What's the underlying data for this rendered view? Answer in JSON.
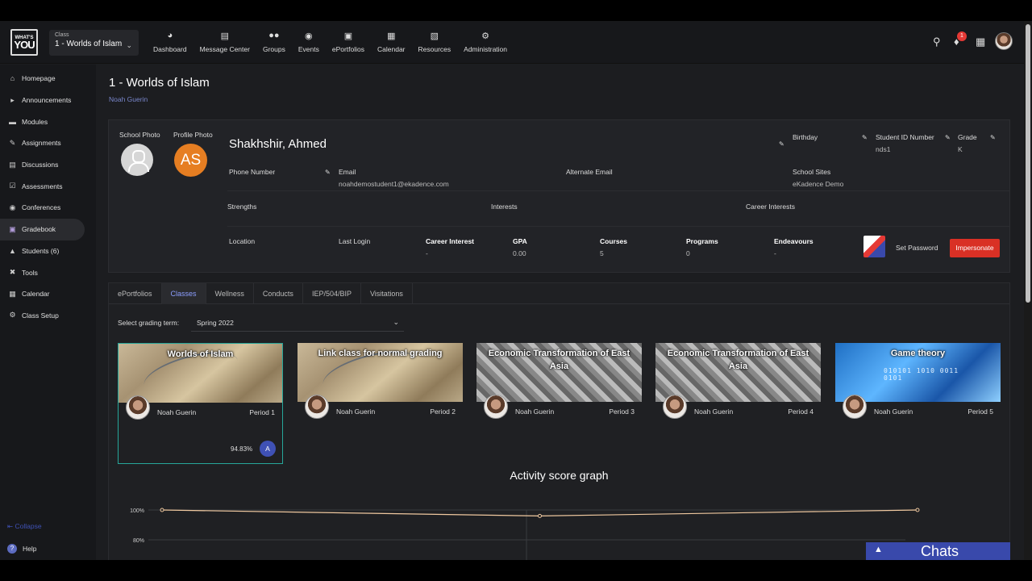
{
  "topbar": {
    "logo_line1": "WHAT'S",
    "logo_line2": "YOU",
    "class_caption": "Class",
    "class_value": "1 - Worlds of Islam",
    "nav": [
      {
        "label": "Dashboard",
        "icon": "dashboard-icon"
      },
      {
        "label": "Message Center",
        "icon": "message-icon"
      },
      {
        "label": "Groups",
        "icon": "groups-icon"
      },
      {
        "label": "Events",
        "icon": "map-pin-icon"
      },
      {
        "label": "ePortfolios",
        "icon": "portfolio-icon"
      },
      {
        "label": "Calendar",
        "icon": "calendar-icon"
      },
      {
        "label": "Resources",
        "icon": "resources-icon"
      },
      {
        "label": "Administration",
        "icon": "cogs-icon"
      }
    ],
    "notification_count": "1"
  },
  "sidebar": {
    "items": [
      {
        "label": "Homepage",
        "icon": "home-icon"
      },
      {
        "label": "Announcements",
        "icon": "megaphone-icon"
      },
      {
        "label": "Modules",
        "icon": "folder-icon"
      },
      {
        "label": "Assignments",
        "icon": "assignment-icon"
      },
      {
        "label": "Discussions",
        "icon": "discussion-icon"
      },
      {
        "label": "Assessments",
        "icon": "assessment-icon"
      },
      {
        "label": "Conferences",
        "icon": "conference-icon"
      },
      {
        "label": "Gradebook",
        "icon": "gradebook-icon"
      },
      {
        "label": "Students (6)",
        "icon": "graduation-cap-icon"
      },
      {
        "label": "Tools",
        "icon": "tools-icon"
      },
      {
        "label": "Calendar",
        "icon": "calendar-icon"
      },
      {
        "label": "Class Setup",
        "icon": "gear-icon"
      }
    ],
    "collapse_label": "Collapse",
    "help_label": "Help"
  },
  "page": {
    "title": "1 - Worlds of Islam",
    "teacher": "Noah Guerin"
  },
  "profile": {
    "school_photo_label": "School Photo",
    "profile_photo_label": "Profile Photo",
    "initials": "AS",
    "name": "Shakhshir, Ahmed",
    "birthday_label": "Birthday",
    "student_id_label": "Student ID Number",
    "student_id_value": "nds1",
    "grade_label": "Grade",
    "grade_value": "K",
    "phone_label": "Phone Number",
    "email_label": "Email",
    "email_value": "noahdemostudent1@ekadence.com",
    "alt_email_label": "Alternate Email",
    "school_sites_label": "School Sites",
    "school_sites_value": "eKadence Demo",
    "strengths_label": "Strengths",
    "interests_label": "Interests",
    "career_interests_label": "Career Interests",
    "location_label": "Location",
    "last_login_label": "Last Login",
    "career_interest_label": "Career Interest",
    "career_interest_value": "-",
    "gpa_label": "GPA",
    "gpa_value": "0.00",
    "courses_label": "Courses",
    "courses_value": "5",
    "programs_label": "Programs",
    "programs_value": "0",
    "endeavours_label": "Endeavours",
    "endeavours_value": "-",
    "set_password_label": "Set Password",
    "impersonate_label": "Impersonate"
  },
  "tabs": [
    "ePortfolios",
    "Classes",
    "Wellness",
    "Conducts",
    "IEP/504/BIP",
    "Visitations"
  ],
  "active_tab": "Classes",
  "term": {
    "label": "Select grading term:",
    "value": "Spring 2022"
  },
  "classes": [
    {
      "title": "Worlds of Islam",
      "teacher": "Noah Guerin",
      "period": "Period 1",
      "score": "94.83%",
      "grade": "A",
      "banner": "map"
    },
    {
      "title": "Link class for normal grading",
      "teacher": "Noah Guerin",
      "period": "Period 2",
      "banner": "map"
    },
    {
      "title": "Economic Transformation of East Asia",
      "teacher": "Noah Guerin",
      "period": "Period 3",
      "banner": "money"
    },
    {
      "title": "Economic Transformation of East Asia",
      "teacher": "Noah Guerin",
      "period": "Period 4",
      "banner": "money"
    },
    {
      "title": "Game theory",
      "teacher": "Noah Guerin",
      "period": "Period 5",
      "banner": "game"
    }
  ],
  "graph": {
    "title": "Activity score graph",
    "y_tick_top": "100%",
    "y_tick_bottom": "80%"
  },
  "chart_data": {
    "type": "line",
    "title": "Activity score graph",
    "x": [
      1,
      2,
      3
    ],
    "values": [
      100,
      96,
      100
    ],
    "yticks": [
      "100%",
      "80%"
    ],
    "ylim": [
      80,
      100
    ]
  },
  "chats": {
    "label": "Chats"
  },
  "colors": {
    "accent": "#3f51b5",
    "impersonate": "#d93025",
    "active_card_border": "#26a69a",
    "profile_orange": "#e67e22"
  }
}
